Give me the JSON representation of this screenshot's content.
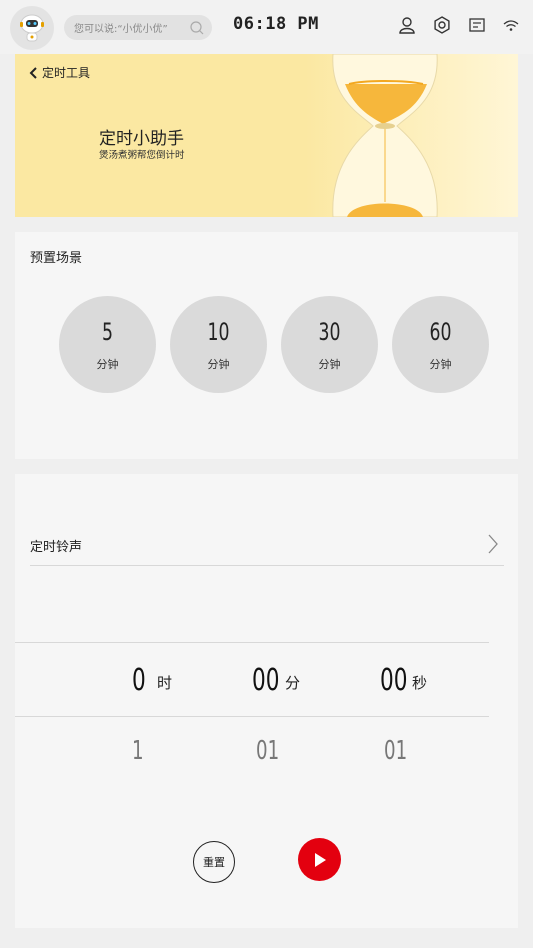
{
  "status": {
    "search_placeholder": "您可以说:“小优小优”",
    "time": "06:18 PM"
  },
  "banner": {
    "back_label": "定时工具",
    "title": "定时小助手",
    "subtitle": "煲汤煮粥帮您倒计时"
  },
  "presets": {
    "title": "预置场景",
    "items": [
      {
        "value": "5",
        "unit": "分钟"
      },
      {
        "value": "10",
        "unit": "分钟"
      },
      {
        "value": "30",
        "unit": "分钟"
      },
      {
        "value": "60",
        "unit": "分钟"
      }
    ]
  },
  "timer": {
    "ringtone_label": "定时铃声",
    "hours": {
      "value": "0",
      "unit": "时",
      "next": "1"
    },
    "minutes": {
      "value": "00",
      "unit": "分",
      "next": "01"
    },
    "seconds": {
      "value": "00",
      "unit": "秒",
      "next": "01"
    },
    "reset_label": "重置"
  },
  "colors": {
    "accent": "#e3000f",
    "banner_bg": "#fbe8a2"
  }
}
